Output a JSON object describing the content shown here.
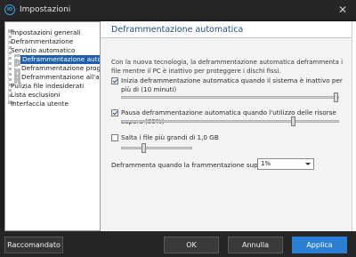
{
  "window": {
    "title": "Impostazioni",
    "close_symbol": "✕",
    "app_icon": "iobit-logo-icon",
    "app_icon_text": "IO"
  },
  "sidebar": {
    "items": [
      {
        "label": "Impostazioni generali",
        "level": 1
      },
      {
        "label": "Deframmentazione",
        "level": 1
      },
      {
        "label": "Servizio automatico",
        "level": 1
      },
      {
        "label": "Deframmentazione automat",
        "level": 2,
        "selected": true
      },
      {
        "label": "Deframmentazione program",
        "level": 2
      },
      {
        "label": "Deframmentazione all'avvio",
        "level": 2
      },
      {
        "label": "Pulizia file indesiderati",
        "level": 1
      },
      {
        "label": "Lista esclusioni",
        "level": 1
      },
      {
        "label": "Interfaccia utente",
        "level": 1
      }
    ]
  },
  "main": {
    "title": "Deframmentazione automatica",
    "description": "Con la nuova tecnologia, la deframmentazione automatica deframmenta i file mentre il PC è inattivo per proteggere i dischi fissi.",
    "options": [
      {
        "label": "Inizia deframmentazione automatica quando il sistema è inattivo per più di (10 minuti)",
        "checked": true,
        "slider_fraction": 1.0
      },
      {
        "label": "Pausa deframmentazione automatica quando l'utilizzo delle risorse supera (80%)",
        "checked": true,
        "slider_fraction": 0.8
      },
      {
        "label": "Salta i file più grandi di 1,0 GB",
        "checked": false,
        "slider_fraction": 0.3
      }
    ],
    "threshold_label": "Deframmenta quando la frammentazione supera il:",
    "threshold_value": "1%"
  },
  "footer": {
    "recommended": "Raccomandato",
    "ok": "OK",
    "cancel": "Annulla",
    "apply": "Applica"
  },
  "colors": {
    "accent": "#2a7fd4",
    "selection": "#1f5fa8",
    "header_text": "#1e4f84",
    "chrome": "#262626"
  }
}
